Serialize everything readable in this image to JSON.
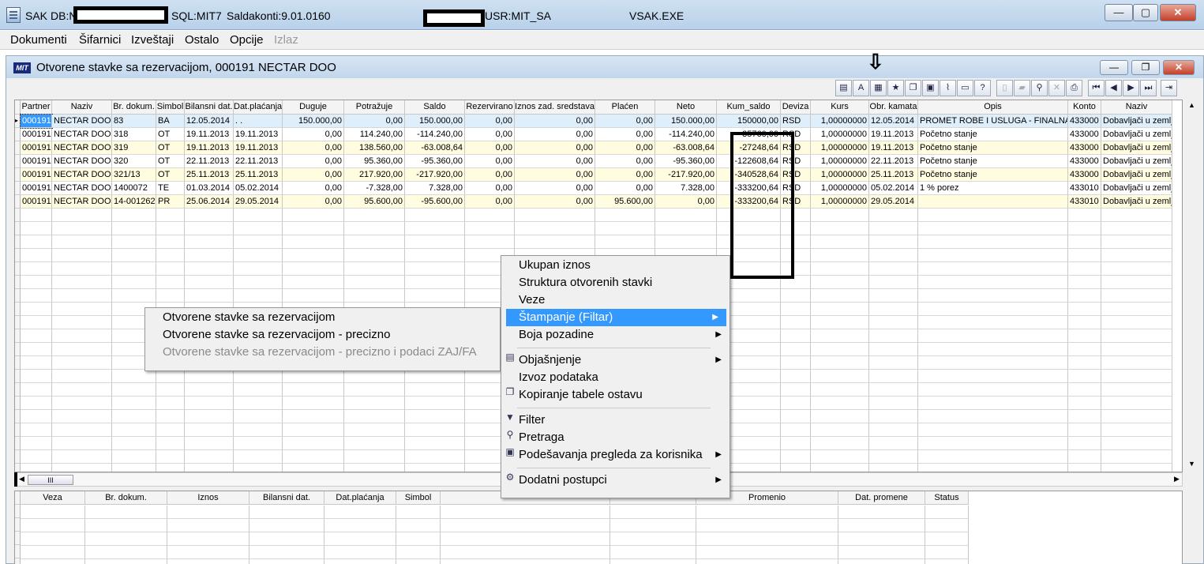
{
  "window": {
    "title_app": "SAK",
    "title_db": "DB:N",
    "title_sql": "SQL:MIT7",
    "title_saldakonti": "Saldakonti:9.01.0160",
    "title_usr": "USR:MIT_SA",
    "title_exe": "VSAK.EXE",
    "buttons": {
      "min": "—",
      "max": "▢",
      "close": "✕"
    }
  },
  "menubar": {
    "items": [
      "Dokumenti",
      "Šifarnici",
      "Izveštaji",
      "Ostalo",
      "Opcije"
    ],
    "disabled": "Izlaz"
  },
  "child": {
    "logo": "MIT",
    "title": "Otvorene stavke sa rezervacijom, 000191 NECTAR DOO",
    "buttons": {
      "min": "—",
      "max": "❐",
      "close": "✕"
    }
  },
  "grid": {
    "columns": [
      "Partner",
      "Naziv",
      "Br. dokum.",
      "Simbol",
      "Bilansni dat.",
      "Dat.plaćanja",
      "Duguje",
      "Potražuje",
      "Saldo",
      "Rezervirano",
      "Iznos zad. sredstava",
      "Plaćen",
      "Neto",
      "Kum_saldo",
      "Deviza",
      "Kurs",
      "Obr. kamata",
      "Opis",
      "Konto",
      "Naziv"
    ],
    "rows": [
      [
        "000191",
        "NECTAR DOO",
        "83",
        "BA",
        "12.05.2014",
        ". .",
        "150.000,00",
        "0,00",
        "150.000,00",
        "0,00",
        "0,00",
        "0,00",
        "150.000,00",
        "150000,00",
        "RSD",
        "1,00000000",
        "12.05.2014",
        "PROMET ROBE I USLUGA - FINALNA",
        "433000",
        "Dobavljači u zemlji"
      ],
      [
        "000191",
        "NECTAR DOO",
        "318",
        "OT",
        "19.11.2013",
        "19.11.2013",
        "0,00",
        "114.240,00",
        "-114.240,00",
        "0,00",
        "0,00",
        "0,00",
        "-114.240,00",
        "35760,00",
        "RSD",
        "1,00000000",
        "19.11.2013",
        "Početno stanje",
        "433000",
        "Dobavljači u zemlji"
      ],
      [
        "000191",
        "NECTAR DOO",
        "319",
        "OT",
        "19.11.2013",
        "19.11.2013",
        "0,00",
        "138.560,00",
        "-63.008,64",
        "0,00",
        "0,00",
        "0,00",
        "-63.008,64",
        "-27248,64",
        "RSD",
        "1,00000000",
        "19.11.2013",
        "Početno stanje",
        "433000",
        "Dobavljači u zemlji"
      ],
      [
        "000191",
        "NECTAR DOO",
        "320",
        "OT",
        "22.11.2013",
        "22.11.2013",
        "0,00",
        "95.360,00",
        "-95.360,00",
        "0,00",
        "0,00",
        "0,00",
        "-95.360,00",
        "-122608,64",
        "RSD",
        "1,00000000",
        "22.11.2013",
        "Početno stanje",
        "433000",
        "Dobavljači u zemlji"
      ],
      [
        "000191",
        "NECTAR DOO",
        "321/13",
        "OT",
        "25.11.2013",
        "25.11.2013",
        "0,00",
        "217.920,00",
        "-217.920,00",
        "0,00",
        "0,00",
        "0,00",
        "-217.920,00",
        "-340528,64",
        "RSD",
        "1,00000000",
        "25.11.2013",
        "Početno stanje",
        "433000",
        "Dobavljači u zemlji"
      ],
      [
        "000191",
        "NECTAR DOO",
        "1400072",
        "TE",
        "01.03.2014",
        "05.02.2014",
        "0,00",
        "-7.328,00",
        "7.328,00",
        "0,00",
        "0,00",
        "0,00",
        "7.328,00",
        "-333200,64",
        "RSD",
        "1,00000000",
        "05.02.2014",
        "1 % porez",
        "433010",
        "Dobavljači u zemlji"
      ],
      [
        "000191",
        "NECTAR DOO",
        "14-001262",
        "PR",
        "25.06.2014",
        "29.05.2014",
        "0,00",
        "95.600,00",
        "-95.600,00",
        "0,00",
        "0,00",
        "95.600,00",
        "0,00",
        "-333200,64",
        "RSD",
        "1,00000000",
        "29.05.2014",
        "",
        "433010",
        "Dobavljači u zemlji"
      ]
    ],
    "hscroll_thumb": "III"
  },
  "grid2": {
    "columns": [
      "Veza",
      "Br. dokum.",
      "Iznos",
      "Bilansni dat.",
      "Dat.plaćanja",
      "Simbol",
      "Promenio",
      "Dat. promene",
      "Status"
    ]
  },
  "context_menu": {
    "items": [
      "Ukupan iznos",
      "Struktura otvorenih stavki",
      "Veze",
      "Štampanje (Filtar)",
      "Boja pozadine",
      "Objašnjenje",
      "Izvoz podataka",
      "Kopiranje tabele ostavu",
      "Filter",
      "Pretraga",
      "Podešavanja pregleda za korisnika",
      "Dodatni postupci"
    ]
  },
  "submenu": {
    "items": [
      "Otvorene stavke sa rezervacijom",
      "Otvorene stavke sa rezervacijom - precizno",
      "Otvorene stavke sa rezervacijom - precizno i podaci ZAJ/FA"
    ]
  },
  "annotation_arrow": "⇩"
}
